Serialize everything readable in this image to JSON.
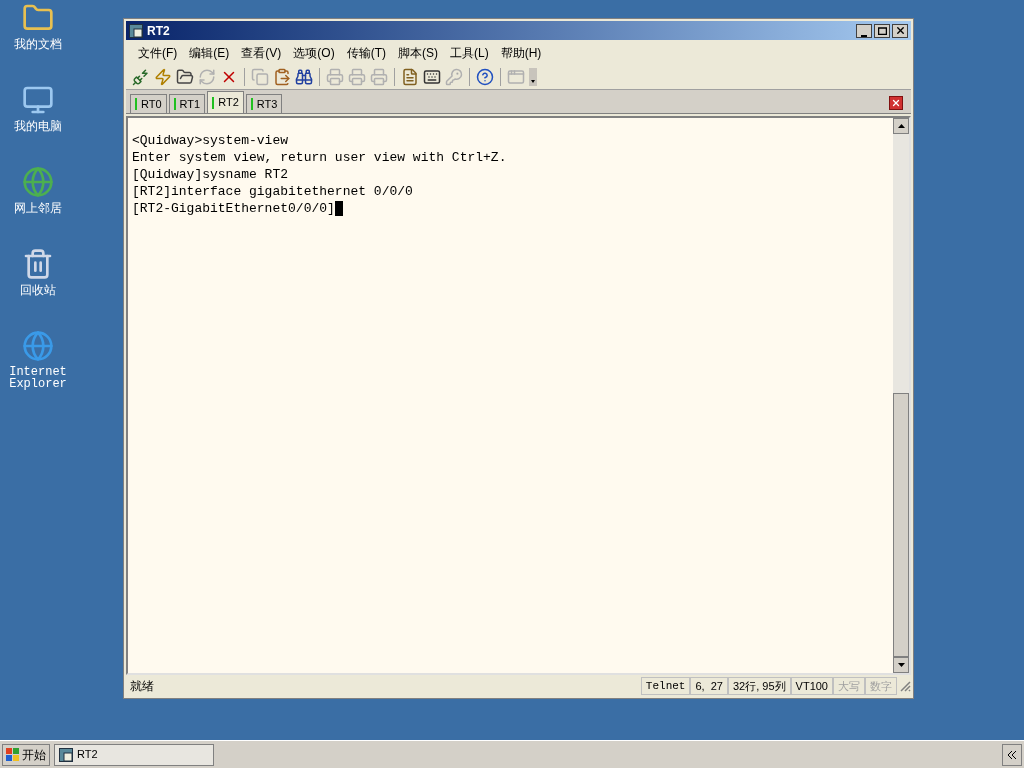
{
  "desktop_icons": [
    {
      "kind": "folder",
      "label": "我的文档"
    },
    {
      "kind": "computer",
      "label": "我的电脑"
    },
    {
      "kind": "network",
      "label": "网上邻居"
    },
    {
      "kind": "recycle",
      "label": "回收站"
    },
    {
      "kind": "browser",
      "label": "Internet Explorer"
    }
  ],
  "window": {
    "title": "RT2"
  },
  "menu": [
    "文件(F)",
    "编辑(E)",
    "查看(V)",
    "选项(O)",
    "传输(T)",
    "脚本(S)",
    "工具(L)",
    "帮助(H)"
  ],
  "toolbar": [
    {
      "kind": "connect",
      "disabled": false
    },
    {
      "kind": "quick-connect",
      "disabled": false
    },
    {
      "kind": "session",
      "disabled": false
    },
    {
      "kind": "reconnect",
      "disabled": true
    },
    {
      "kind": "disconnect",
      "disabled": false
    },
    {
      "kind": "sep"
    },
    {
      "kind": "copy",
      "disabled": true
    },
    {
      "kind": "paste",
      "disabled": false
    },
    {
      "kind": "find",
      "disabled": false
    },
    {
      "kind": "sep"
    },
    {
      "kind": "print",
      "disabled": true
    },
    {
      "kind": "print-setup",
      "disabled": true
    },
    {
      "kind": "printer",
      "disabled": true
    },
    {
      "kind": "sep"
    },
    {
      "kind": "options",
      "disabled": false
    },
    {
      "kind": "keymap",
      "disabled": false
    },
    {
      "kind": "key",
      "disabled": true
    },
    {
      "kind": "sep"
    },
    {
      "kind": "help",
      "disabled": false
    },
    {
      "kind": "sep"
    },
    {
      "kind": "window",
      "disabled": true
    }
  ],
  "tabs": [
    {
      "label": "RT0",
      "selected": false
    },
    {
      "label": "RT1",
      "selected": false
    },
    {
      "label": "RT2",
      "selected": true
    },
    {
      "label": "RT3",
      "selected": false
    }
  ],
  "terminal": {
    "lines": [
      "<Quidway>system-view",
      "Enter system view, return user view with Ctrl+Z.",
      "[Quidway]sysname RT2",
      "[RT2]interface gigabitethernet 0/0/0",
      "[RT2-GigabitEthernet0/0/0]"
    ]
  },
  "status_bar": [
    {
      "text": "就绪",
      "disabled": false
    },
    {
      "text": "Telnet",
      "disabled": false
    },
    {
      "text": "6,  27",
      "disabled": false
    },
    {
      "text": "32行, 95列",
      "disabled": false
    },
    {
      "text": "VT100",
      "disabled": false
    },
    {
      "text": "大写",
      "disabled": true
    },
    {
      "text": "数字",
      "disabled": true
    }
  ],
  "taskbar": {
    "start": "开始",
    "tasks": [
      {
        "label": "RT2",
        "selected": true
      }
    ]
  }
}
